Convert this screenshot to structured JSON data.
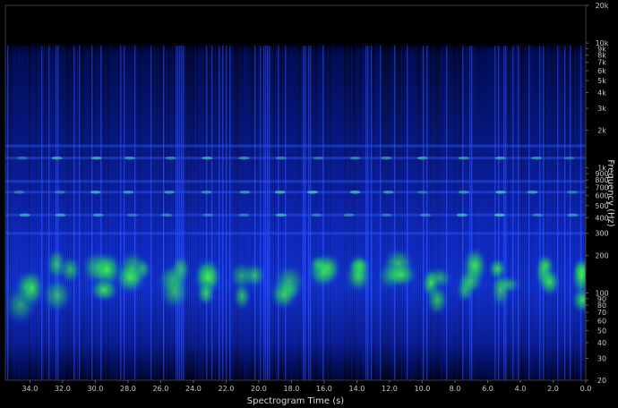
{
  "chart_data": {
    "type": "heatmap",
    "title": "",
    "xlabel": "Spectrogram Time (s)",
    "ylabel": "Frequency (Hz)",
    "x_axis": {
      "direction": "reversed",
      "range": [
        35.5,
        0.0
      ],
      "ticks": [
        "34.0",
        "32.0",
        "30.0",
        "28.0",
        "26.0",
        "24.0",
        "22.0",
        "20.0",
        "18.0",
        "16.0",
        "14.0",
        "12.0",
        "10.0",
        "8.0",
        "6.0",
        "4.0",
        "2.0",
        "0.0"
      ],
      "tick_values": [
        34,
        32,
        30,
        28,
        26,
        24,
        22,
        20,
        18,
        16,
        14,
        12,
        10,
        8,
        6,
        4,
        2,
        0
      ]
    },
    "y_axis": {
      "scale": "log",
      "side": "right",
      "range": [
        20,
        20000
      ],
      "ticks": [
        "20",
        "30",
        "40",
        "50",
        "60",
        "70",
        "80",
        "90",
        "100",
        "200",
        "300",
        "400",
        "500",
        "600",
        "700",
        "800",
        "900",
        "1k",
        "2k",
        "3k",
        "4k",
        "5k",
        "6k",
        "7k",
        "8k",
        "9k",
        "10k",
        "20k"
      ],
      "tick_values": [
        20,
        30,
        40,
        50,
        60,
        70,
        80,
        90,
        100,
        200,
        300,
        400,
        500,
        600,
        700,
        800,
        900,
        1000,
        2000,
        3000,
        4000,
        5000,
        6000,
        7000,
        8000,
        9000,
        10000,
        20000
      ]
    },
    "colors": {
      "background": "#000000",
      "low": "#0a1aa0",
      "mid": "#1f4cff",
      "high": "#3de83d"
    },
    "grid": false,
    "legend": "none"
  }
}
